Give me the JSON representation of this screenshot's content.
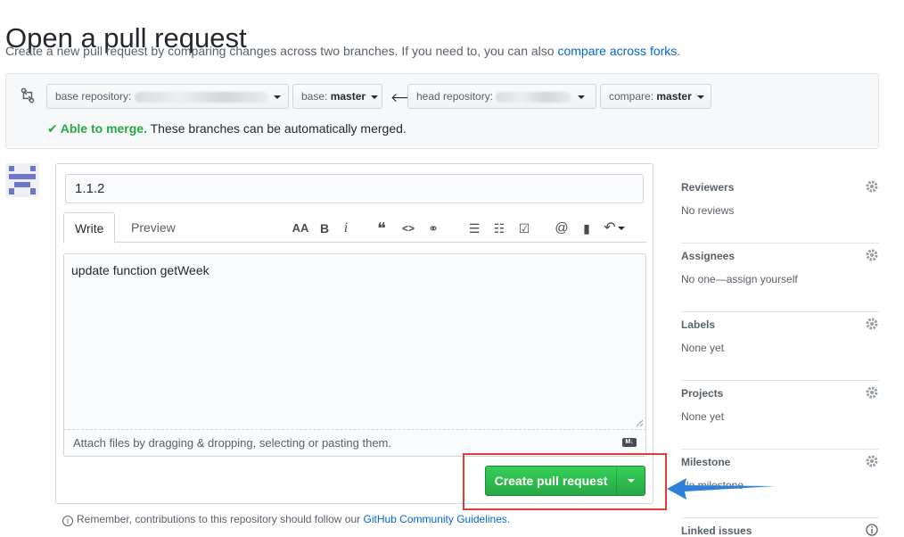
{
  "page": {
    "title": "Open a pull request",
    "subtitle_text": "Create a new pull request by comparing changes across two branches. If you need to, you can also ",
    "subtitle_link": "compare across forks",
    "subtitle_end": "."
  },
  "compare": {
    "base_repo_label": "base repository:",
    "base_label": "base:",
    "base_value": "master",
    "head_repo_label": "head repository:",
    "compare_label": "compare:",
    "compare_value": "master",
    "merge_ok": "Able to merge.",
    "merge_text": " These branches can be automatically merged."
  },
  "form": {
    "title_value": "1.1.2",
    "tab_write": "Write",
    "tab_preview": "Preview",
    "toolbar": {
      "header": "AA",
      "bold": "B",
      "italic": "i",
      "quote": "❝",
      "code": "<>",
      "link": "⚭",
      "ul": "☰",
      "ol": "☷",
      "task": "☑",
      "mention": "@",
      "ref": "▮",
      "reply": "↶"
    },
    "body_value": "update function getWeek",
    "attach_text": "Attach files by dragging & dropping, selecting or pasting them.",
    "md_badge": "M↓",
    "create_label": "Create pull request"
  },
  "footer": {
    "remember_text": "Remember, contributions to this repository should follow our ",
    "remember_link": "GitHub Community Guidelines",
    "remember_end": "."
  },
  "sidebar": {
    "sections": [
      {
        "title": "Reviewers",
        "value": "No reviews"
      },
      {
        "title": "Assignees",
        "value": "No one—assign yourself"
      },
      {
        "title": "Labels",
        "value": "None yet"
      },
      {
        "title": "Projects",
        "value": "None yet"
      },
      {
        "title": "Milestone",
        "value": "No milestone"
      }
    ],
    "linked_title": "Linked issues"
  },
  "colors": {
    "accent_green": "#28a745",
    "link_blue": "#0366d6",
    "highlight_red": "#e03c3c",
    "annotation_blue": "#2f80d8"
  }
}
